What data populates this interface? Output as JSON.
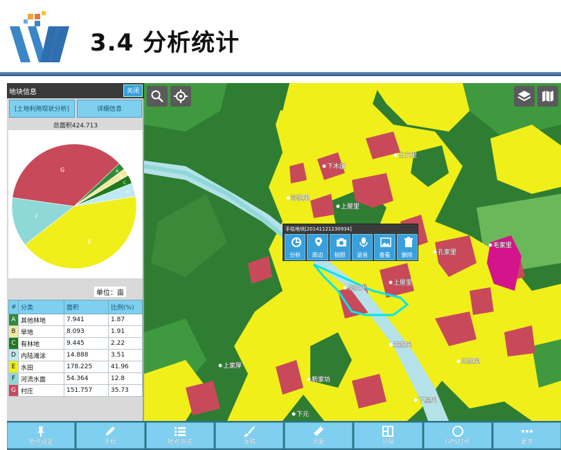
{
  "slide": {
    "title": "3.4 分析统计"
  },
  "panel": {
    "title": "地块信息",
    "close_label": "关闭",
    "analysis_button": "[土地利用现状分析]",
    "detail_button": "详细信息",
    "total_area": "总面积424.713",
    "unit_label": "单位：亩",
    "table_headers": [
      "#",
      "分类",
      "面积",
      "比例(%)"
    ]
  },
  "chart_data": {
    "type": "pie",
    "slices": [
      {
        "code": "A",
        "name": "其他林地",
        "area": "7.941",
        "percent": "1.87",
        "value": 1.87,
        "color": "#2e8b3a"
      },
      {
        "code": "B",
        "name": "旱地",
        "area": "8.093",
        "percent": "1.91",
        "value": 1.91,
        "color": "#f3e8a0"
      },
      {
        "code": "C",
        "name": "有林地",
        "area": "9.445",
        "percent": "2.22",
        "value": 2.22,
        "color": "#1f7a1f"
      },
      {
        "code": "D",
        "name": "内陆滩涂",
        "area": "14.888",
        "percent": "3.51",
        "value": 3.51,
        "color": "#bfe9f2"
      },
      {
        "code": "E",
        "name": "水田",
        "area": "178.225",
        "percent": "41.96",
        "value": 41.96,
        "color": "#f0ef1a"
      },
      {
        "code": "F",
        "name": "河流水面",
        "area": "54.364",
        "percent": "12.8",
        "value": 12.8,
        "color": "#8fd8d8"
      },
      {
        "code": "G",
        "name": "村庄",
        "area": "151.757",
        "percent": "35.73",
        "value": 35.73,
        "color": "#c84a5a"
      }
    ]
  },
  "popup": {
    "title": "手绘地块[20141121230934]",
    "actions": [
      "分析",
      "周边",
      "拍照",
      "录音",
      "查看",
      "删除"
    ]
  },
  "toolbar": {
    "items": [
      "地点设定",
      "手绘",
      "地点浏览",
      "涂鸦",
      "测距",
      "分屏",
      "GPS打点",
      "更多"
    ]
  },
  "map": {
    "places": [
      "白庆里",
      "下木田",
      "彭家里",
      "上屋里",
      "邬家里",
      "上屋里",
      "毛家里",
      "孔家里",
      "黄家里",
      "新家坊",
      "上家厚",
      "下屋里",
      "苏家里",
      "下元"
    ]
  },
  "colors": {
    "accent": "#3aa0dc",
    "toolbar": "#7fd0f0",
    "forest": "#2e7d32",
    "paddy": "#f0ef1a",
    "village": "#c84a5a",
    "river": "#8fd8d8"
  }
}
